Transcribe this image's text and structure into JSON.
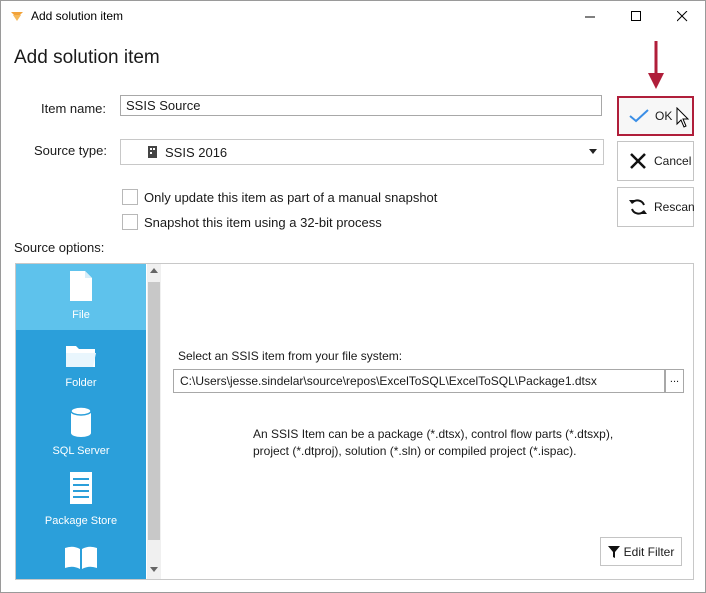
{
  "window": {
    "title": "Add solution item",
    "controls": {
      "minimize": "minimize",
      "maximize": "maximize",
      "close": "close"
    }
  },
  "heading": "Add solution item",
  "form": {
    "item_name_label": "Item name:",
    "item_name_value": "SSIS Source",
    "source_type_label": "Source type:",
    "source_type_value": "SSIS 2016",
    "checkbox_manual_snapshot": "Only update this item as part of a manual snapshot",
    "checkbox_32bit": "Snapshot this item using a 32-bit process",
    "source_options_label": "Source options:"
  },
  "buttons": {
    "ok": "OK",
    "cancel": "Cancel",
    "rescan": "Rescan"
  },
  "source_nav": [
    {
      "label": "File",
      "icon": "file-icon",
      "active": true
    },
    {
      "label": "Folder",
      "icon": "folder-icon",
      "active": false
    },
    {
      "label": "SQL Server",
      "icon": "database-icon",
      "active": false
    },
    {
      "label": "Package Store",
      "icon": "package-store-icon",
      "active": false
    },
    {
      "label": "",
      "icon": "book-icon",
      "active": false
    }
  ],
  "file_panel": {
    "prompt": "Select an SSIS item from your file system:",
    "path": "C:\\Users\\jesse.sindelar\\source\\repos\\ExcelToSQL\\ExcelToSQL\\Package1.dtsx",
    "browse_label": "...",
    "hint_line1": "An SSIS Item can be a package (*.dtsx), control flow parts (*.dtsxp),",
    "hint_line2": "project (*.dtproj), solution (*.sln) or compiled project (*.ispac).",
    "edit_filter": "Edit Filter"
  },
  "colors": {
    "nav_background": "#2b9fda",
    "nav_active": "#5ec2ec",
    "annotation": "#b01e3a"
  }
}
